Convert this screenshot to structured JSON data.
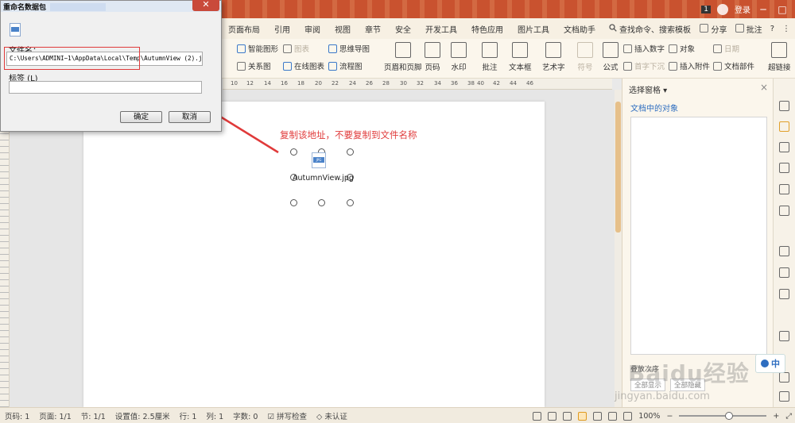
{
  "titlebar": {
    "badge_number": "1",
    "user_label": "登录",
    "minimize": "─",
    "maximize": "□",
    "close": "×"
  },
  "menu": {
    "items": [
      "页面布局",
      "引用",
      "审阅",
      "视图",
      "章节",
      "安全",
      "开发工具",
      "特色应用",
      "图片工具",
      "文档助手"
    ],
    "search": "查找命令、搜索模板",
    "share": "分享",
    "comment": "批注",
    "help": "?",
    "more": "⋮"
  },
  "ribbon": {
    "smart_shape": "智能图形",
    "chart": "图表",
    "mindmap": "思维导图",
    "relation": "关系图",
    "online_chart": "在线图表",
    "flowchart": "流程图",
    "header_footer": "页眉和页脚",
    "page_number": "页码",
    "watermark": "水印",
    "comment": "批注",
    "textbox": "文本框",
    "wordart": "艺术字",
    "symbol": "符号",
    "formula": "公式",
    "insert_number": "插入数字",
    "object": "对象",
    "date": "日期",
    "drop_cap": "首字下沉",
    "attach": "插入附件",
    "doc_parts": "文档部件",
    "hyperlink": "超链接"
  },
  "ruler": {
    "marks": [
      "10",
      "12",
      "14",
      "16",
      "18",
      "20",
      "22",
      "24",
      "26",
      "28",
      "30",
      "32",
      "34",
      "36",
      "38",
      "40",
      "42",
      "44",
      "46"
    ]
  },
  "document": {
    "annotation": "复制该地址，不要复制到文件名称",
    "file_name": "AutumnView.jpg",
    "file_badge": "JPG"
  },
  "panel": {
    "title": "选择窗格",
    "subtitle": "文档中的对象",
    "show_all": "全部显示",
    "hide_all": "全部隐藏",
    "list_label": "叠放次序"
  },
  "ime": {
    "label": "中"
  },
  "watermark": {
    "brand": "Baidu经验",
    "url": "jingyan.baidu.com"
  },
  "status": {
    "page_num": "页码: 1",
    "pages": "页面: 1/1",
    "section": "节: 1/1",
    "setting": "设置值: 2.5厘米",
    "row": "行: 1",
    "col": "列: 1",
    "words": "字数: 0",
    "spell": "拼写检查",
    "auth": "未认证",
    "zoom": "100%",
    "zoom_out": "−",
    "zoom_in": "+"
  },
  "dialog": {
    "title": "重命名数据包",
    "filename_label": "文件名：",
    "path": "C:\\Users\\ADMINI~1\\AppData\\Local\\Temp\\AutumnView (2).jpg",
    "tag_label": "标签 (L)",
    "ok": "确定",
    "cancel": "取消",
    "close": "✕"
  },
  "colors": {
    "title_bar": "#c9522f",
    "accent_red": "#e03a3a",
    "link_blue": "#2e6ec0",
    "scroll_thumb": "#e6c08a"
  }
}
